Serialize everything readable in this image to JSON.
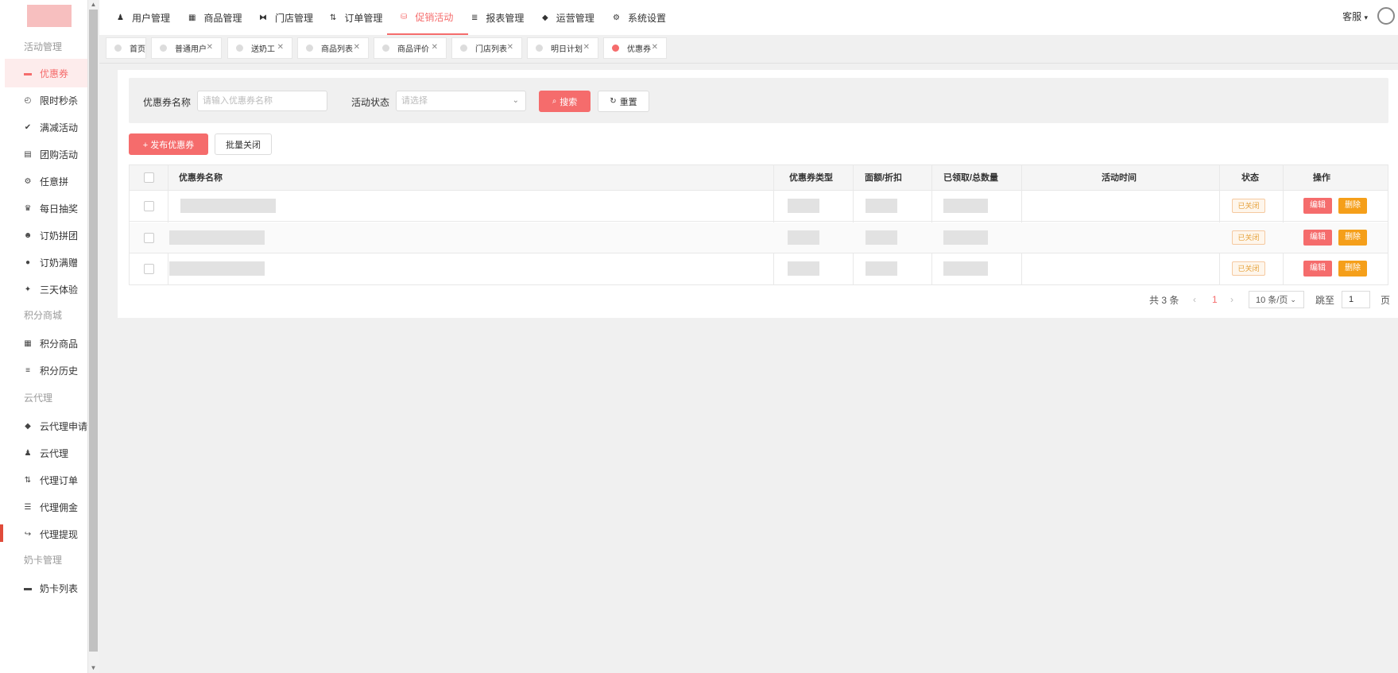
{
  "sidebar": {
    "groups": [
      "活动管理",
      "积分商城",
      "云代理",
      "奶卡管理"
    ],
    "items": [
      {
        "label": "优惠券",
        "icon": "ticket-icon"
      },
      {
        "label": "限时秒杀",
        "icon": "clock-icon"
      },
      {
        "label": "满减活动",
        "icon": "check-icon"
      },
      {
        "label": "团购活动",
        "icon": "bag-icon"
      },
      {
        "label": "任意拼",
        "icon": "gear-icon"
      },
      {
        "label": "每日抽奖",
        "icon": "trophy-icon"
      },
      {
        "label": "订奶拼团",
        "icon": "group-icon"
      },
      {
        "label": "订奶满赠",
        "icon": "gift-icon"
      },
      {
        "label": "三天体验",
        "icon": "run-icon"
      },
      {
        "label": "积分商品",
        "icon": "doc-icon"
      },
      {
        "label": "积分历史",
        "icon": "list-icon"
      },
      {
        "label": "云代理申请",
        "icon": "tag-icon"
      },
      {
        "label": "云代理",
        "icon": "person-icon"
      },
      {
        "label": "代理订单",
        "icon": "sort-icon"
      },
      {
        "label": "代理佣金",
        "icon": "sliders-icon"
      },
      {
        "label": "代理提现",
        "icon": "arrow-icon"
      },
      {
        "label": "奶卡列表",
        "icon": "card-icon"
      }
    ]
  },
  "topnav": {
    "items": [
      {
        "label": "用户管理",
        "icon": "person-icon"
      },
      {
        "label": "商品管理",
        "icon": "doc-icon"
      },
      {
        "label": "门店管理",
        "icon": "store-icon"
      },
      {
        "label": "订单管理",
        "icon": "sort-icon"
      },
      {
        "label": "促销活动",
        "icon": "basket-icon"
      },
      {
        "label": "报表管理",
        "icon": "report-icon"
      },
      {
        "label": "运营管理",
        "icon": "tag-icon"
      },
      {
        "label": "系统设置",
        "icon": "gear-icon"
      }
    ],
    "user": "客服",
    "user_caret": "▾"
  },
  "tags": [
    "首页",
    "普通用户",
    "送奶工",
    "商品列表",
    "商品评价",
    "门店列表",
    "明日计划",
    "优惠券"
  ],
  "search": {
    "name_label": "优惠券名称",
    "name_placeholder": "请输入优惠券名称",
    "status_label": "活动状态",
    "status_placeholder": "请选择",
    "search_btn": "搜索",
    "reset_btn": "重置"
  },
  "actions": {
    "publish": "+ 发布优惠券",
    "batch_close": "批量关闭"
  },
  "table": {
    "columns": [
      "优惠券名称",
      "优惠券类型",
      "面额/折扣",
      "已领取/总数量",
      "活动时间",
      "状态",
      "操作"
    ],
    "rows": [
      {
        "status": "已关闭",
        "edit": "编辑",
        "delete": "删除"
      },
      {
        "status": "已关闭",
        "edit": "编辑",
        "delete": "删除"
      },
      {
        "status": "已关闭",
        "edit": "编辑",
        "delete": "删除"
      }
    ]
  },
  "pagination": {
    "total": "共 3 条",
    "prev": "‹",
    "current": "1",
    "next": "›",
    "page_size": "10 条/页",
    "goto_label": "跳至",
    "goto_value": "1",
    "page_unit": "页"
  },
  "colors": {
    "accent": "#f56c6c",
    "warning": "#f59f1a"
  }
}
